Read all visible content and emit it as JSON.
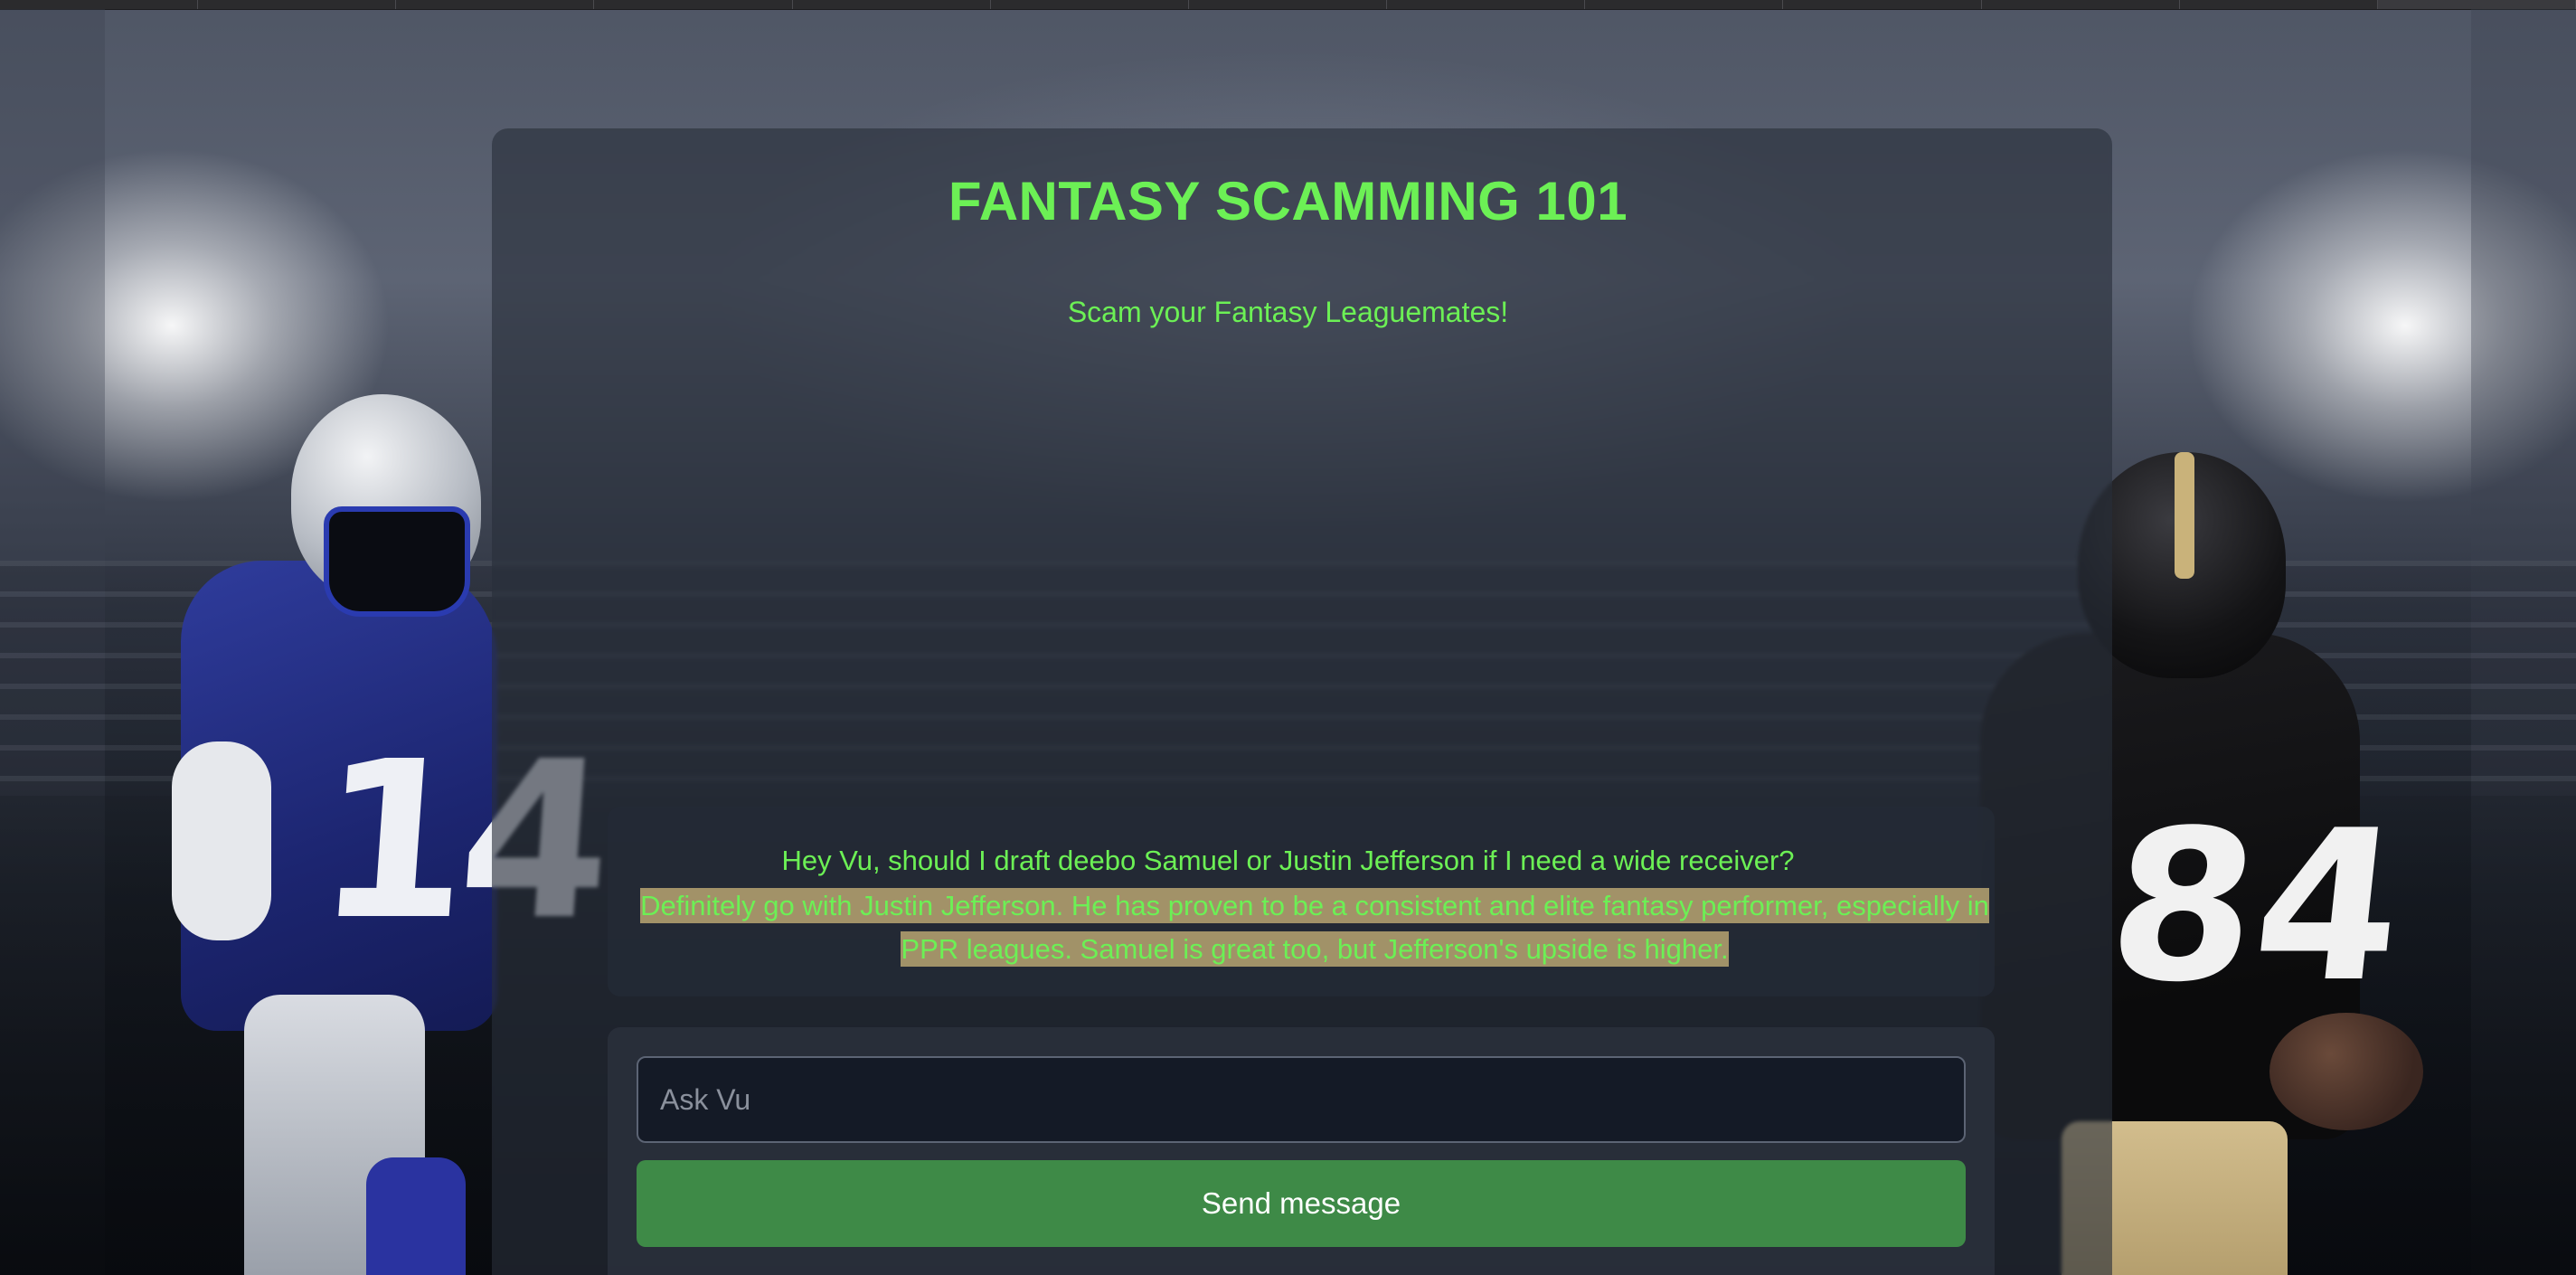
{
  "app": {
    "title": "FANTASY SCAMMING 101",
    "subtitle": "Scam your Fantasy Leaguemates!"
  },
  "chat": {
    "question": "Hey Vu, should I draft deebo Samuel or Justin Jefferson if I need a wide receiver?",
    "answer": "Definitely go with Justin Jefferson. He has proven to be a consistent and elite fantasy performer, especially in PPR leagues. Samuel is great too, but Jefferson's upside is higher."
  },
  "composer": {
    "placeholder": "Ask Vu",
    "value": "",
    "send_label": "Send message"
  },
  "players": {
    "left_number": "14",
    "right_number": "84"
  },
  "colors": {
    "accent": "#6cf055",
    "send_button": "#3e8a47",
    "highlight": "#b4a070"
  }
}
